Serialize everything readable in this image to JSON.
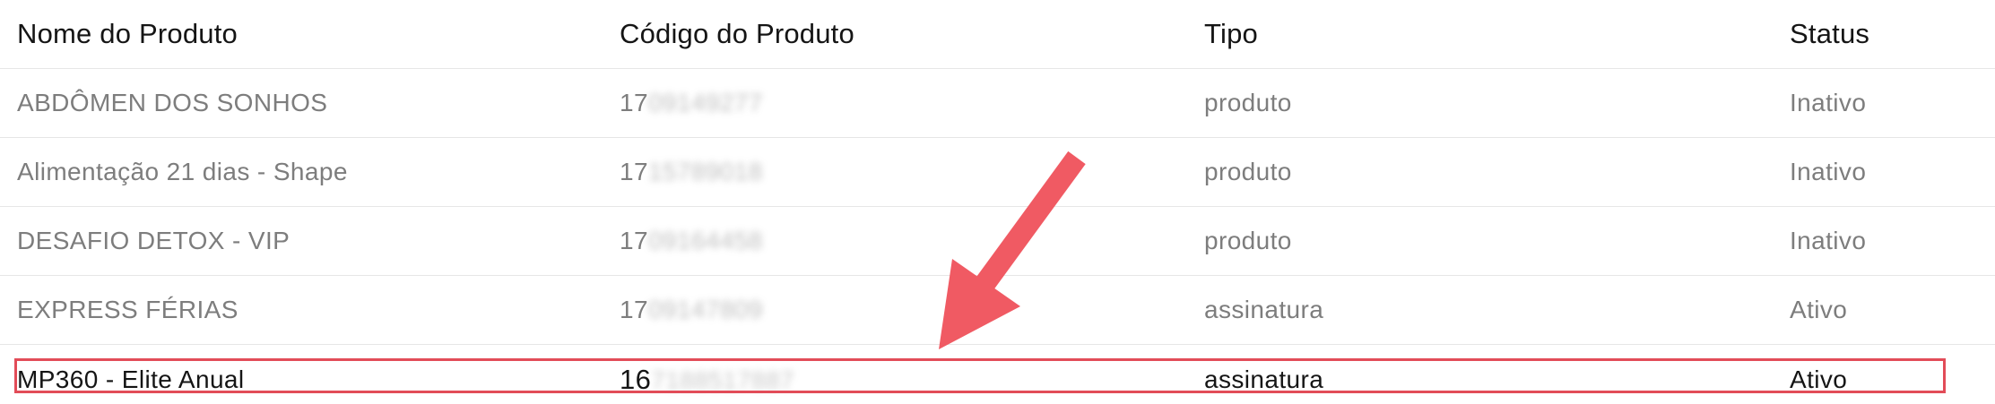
{
  "table": {
    "headers": {
      "name": "Nome do Produto",
      "code": "Código do Produto",
      "type": "Tipo",
      "status": "Status"
    },
    "rows": [
      {
        "name": "ABDÔMEN DOS SONHOS",
        "code_visible": "17",
        "code_blurred": "09149277",
        "type": "produto",
        "status": "Inativo"
      },
      {
        "name": "Alimentação 21 dias - Shape",
        "code_visible": "17",
        "code_blurred": "15789018",
        "type": "produto",
        "status": "Inativo"
      },
      {
        "name": "DESAFIO DETOX - VIP",
        "code_visible": "17",
        "code_blurred": "09164458",
        "type": "produto",
        "status": "Inativo"
      },
      {
        "name": "EXPRESS FÉRIAS",
        "code_visible": "17",
        "code_blurred": "09147809",
        "type": "assinatura",
        "status": "Ativo"
      },
      {
        "name": "MP360 - Elite Anual",
        "code_visible": "16",
        "code_blurred": "7188517887",
        "type": "assinatura",
        "status": "Ativo"
      }
    ],
    "highlighted_row": 4
  },
  "annotation": {
    "arrow_color": "#f05a63",
    "highlight_color": "#e24c58"
  }
}
